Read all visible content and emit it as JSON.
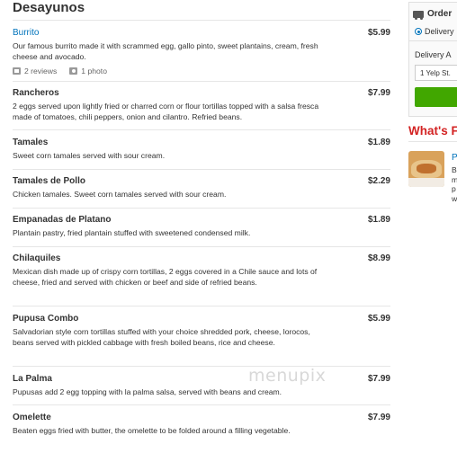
{
  "menu": {
    "section_title": "Desayunos",
    "items": [
      {
        "name": "Burrito",
        "price": "$5.99",
        "description": "Our famous burrito made it with scrammed egg, gallo pinto, sweet plantains, cream, fresh cheese and avocado.",
        "reviews": "2 reviews",
        "photos": "1 photo"
      },
      {
        "name": "Rancheros",
        "price": "$7.99",
        "description": "2 eggs served upon lightly fried or charred corn or flour tortillas topped with a salsa fresca made of tomatoes, chili peppers, onion and cilantro. Refried beans."
      },
      {
        "name": "Tamales",
        "price": "$1.89",
        "description": "Sweet corn tamales served with sour cream."
      },
      {
        "name": "Tamales de Pollo",
        "price": "$2.29",
        "description": "Chicken tamales. Sweet corn tamales served with sour cream."
      },
      {
        "name": "Empanadas de Platano",
        "price": "$1.89",
        "description": "Plantain pastry, fried plantain stuffed with sweetened condensed milk."
      },
      {
        "name": "Chilaquiles",
        "price": "$8.99",
        "description": "Mexican dish made up of crispy corn tortillas, 2 eggs covered in a Chile sauce and lots of cheese, fried and served with chicken or beef and side of refried beans."
      },
      {
        "name": "Pupusa Combo",
        "price": "$5.99",
        "description": "Salvadorian style corn tortillas stuffed with your choice shredded pork, cheese, lorocos, beans served with pickled cabbage with fresh boiled beans, rice and cheese."
      },
      {
        "name": "La Palma",
        "price": "$7.99",
        "description": "Pupusas add 2 egg topping with la palma salsa, served with beans and cream."
      },
      {
        "name": "Omelette",
        "price": "$7.99",
        "description": "Beaten eggs fried with butter, the omelette to be folded around a filling vegetable."
      }
    ]
  },
  "watermark": "menupix",
  "sidebar": {
    "order_title": "Order",
    "delivery_option": "Delivery",
    "delivery_address_label": "Delivery A",
    "address_value": "1 Yelp St.",
    "whats_title": "What's F",
    "promo_link": "P",
    "promo_text_lines": [
      "B",
      "m",
      "p",
      "w"
    ]
  },
  "colors": {
    "link": "#0073bb",
    "accent_red": "#d32323",
    "button_green": "#41a700"
  }
}
